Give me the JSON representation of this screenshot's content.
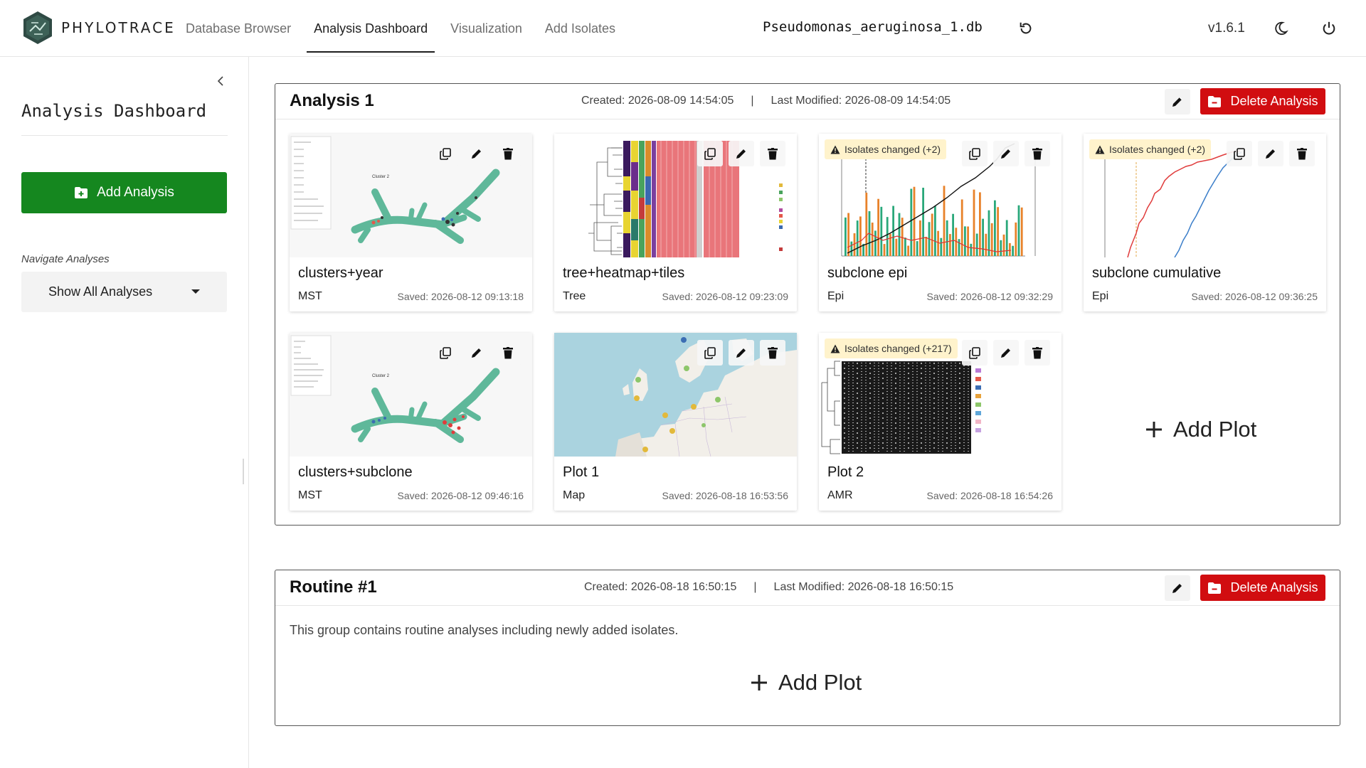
{
  "app": {
    "brand": "PHYLOTRACE",
    "nav_tabs": [
      {
        "label": "Database Browser"
      },
      {
        "label": "Analysis Dashboard"
      },
      {
        "label": "Visualization"
      },
      {
        "label": "Add Isolates"
      }
    ],
    "active_tab": "Analysis Dashboard",
    "database_name": "Pseudomonas_aeruginosa_1.db",
    "version": "v1.6.1",
    "icons": [
      "logo-icon",
      "refresh-icon",
      "moon-icon",
      "power-icon"
    ]
  },
  "sidebar": {
    "title": "Analysis Dashboard",
    "add_analysis_label": "Add Analysis",
    "navigate_label": "Navigate Analyses",
    "navigate_value": "Show All Analyses"
  },
  "colors": {
    "accent_green": "#15871f",
    "delete_red": "#d10d10",
    "warning_bg": "#fff3cc"
  },
  "analyses": [
    {
      "title": "Analysis 1",
      "created": "Created: 2026-08-09 14:54:05",
      "modified": "Last Modified: 2026-08-09 14:54:05",
      "separator": "|",
      "delete_label": "Delete Analysis",
      "add_plot_label": "Add Plot",
      "plots": [
        {
          "title": "clusters+year",
          "type": "MST",
          "saved": "Saved: 2026-08-12 09:13:18",
          "warning": ""
        },
        {
          "title": "tree+heatmap+tiles",
          "type": "Tree",
          "saved": "Saved: 2026-08-12 09:23:09",
          "warning": ""
        },
        {
          "title": "subclone epi",
          "type": "Epi",
          "saved": "Saved: 2026-08-12 09:32:29",
          "warning": "Isolates changed (+2)"
        },
        {
          "title": "subclone cumulative",
          "type": "Epi",
          "saved": "Saved: 2026-08-12 09:36:25",
          "warning": "Isolates changed (+2)"
        },
        {
          "title": "clusters+subclone",
          "type": "MST",
          "saved": "Saved: 2026-08-12 09:46:16",
          "warning": ""
        },
        {
          "title": "Plot 1",
          "type": "Map",
          "saved": "Saved: 2026-08-18 16:53:56",
          "warning": ""
        },
        {
          "title": "Plot 2",
          "type": "AMR",
          "saved": "Saved: 2026-08-18 16:54:26",
          "warning": "Isolates changed (+217)"
        }
      ]
    },
    {
      "title": "Routine #1",
      "created": "Created: 2026-08-18 16:50:15",
      "modified": "Last Modified: 2026-08-18 16:50:15",
      "separator": "|",
      "delete_label": "Delete Analysis",
      "description": "This group contains routine analyses including newly added isolates.",
      "add_plot_label": "Add Plot"
    }
  ]
}
